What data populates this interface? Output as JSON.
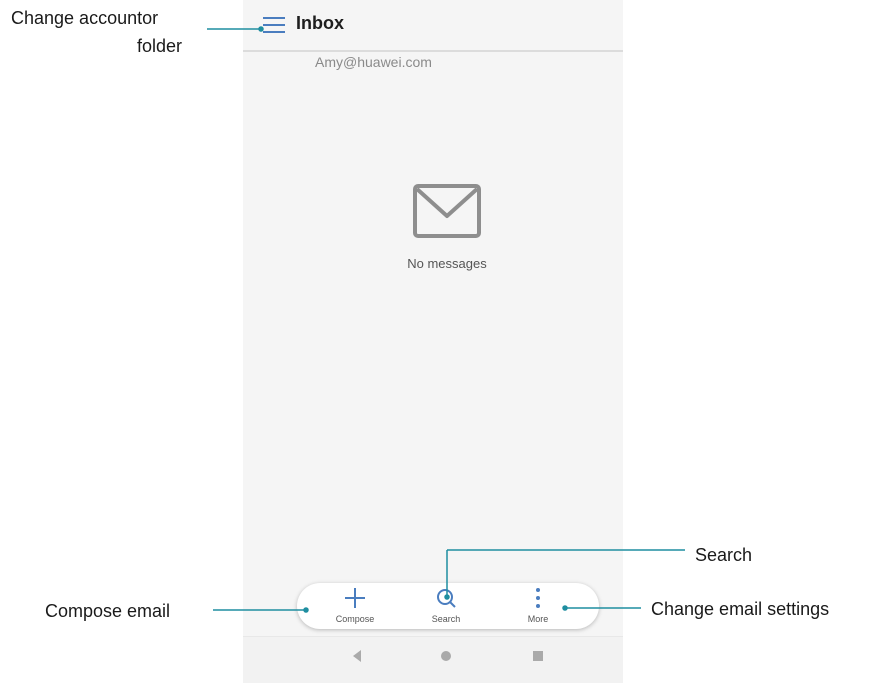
{
  "app": {
    "title": "Inbox",
    "account": "Amy@huawei.com",
    "empty_state": "No messages"
  },
  "bottom_bar": {
    "compose": "Compose",
    "search": "Search",
    "more": "More"
  },
  "annotations": {
    "change_account_line1": "Change accountor",
    "change_account_line2": "folder",
    "search": "Search",
    "compose_email": "Compose email",
    "change_settings": "Change email settings"
  },
  "colors": {
    "accent": "#1f8ea0",
    "menu_icon": "#4a7dbf"
  },
  "icons": [
    "menu-icon",
    "envelope-icon",
    "plus-icon",
    "search-icon",
    "more-vertical-icon",
    "back-triangle-icon",
    "home-circle-icon",
    "recents-square-icon"
  ]
}
